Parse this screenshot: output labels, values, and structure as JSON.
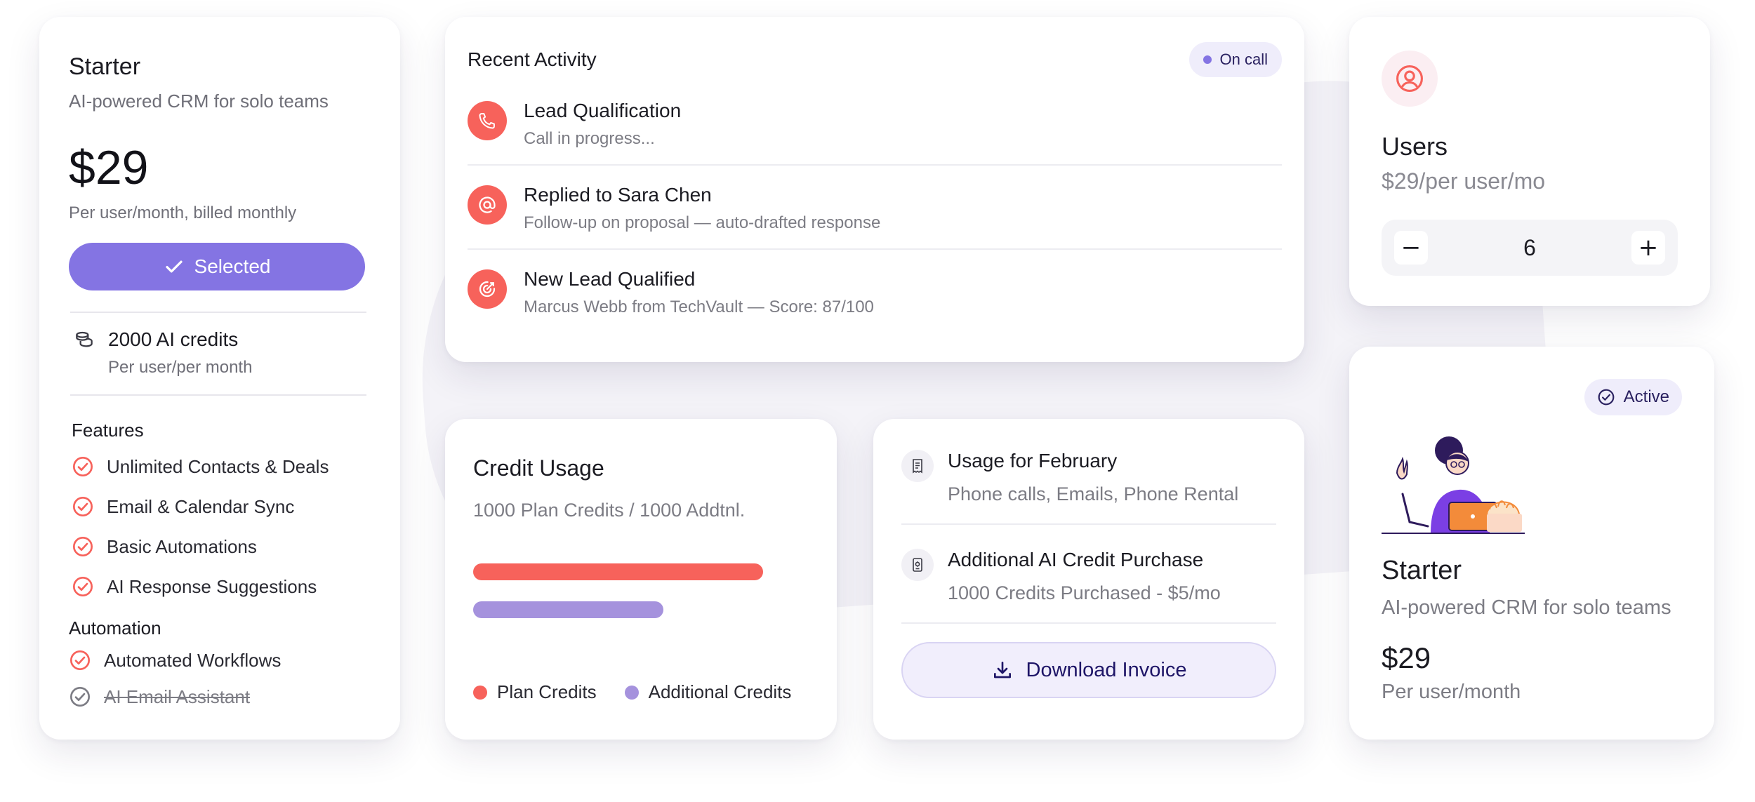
{
  "colors": {
    "accent": "#8474e3",
    "coral": "#f7625b",
    "lavender": "#a592dd"
  },
  "starter_card": {
    "title": "Starter",
    "subtitle": "AI-powered CRM for solo teams",
    "price": "$29",
    "price_note": "Per user/month, billed monthly",
    "selected_label": "Selected",
    "credits_main": "2000 AI credits",
    "credits_sub": "Per user/per month",
    "features_heading": "Features",
    "features": [
      {
        "label": "Unlimited Contacts & Deals"
      },
      {
        "label": "Email & Calendar Sync"
      },
      {
        "label": "Basic Automations"
      },
      {
        "label": "AI Response Suggestions"
      }
    ],
    "automation_heading": "Automation",
    "automation": [
      {
        "label": "Automated Workflows",
        "enabled": true
      },
      {
        "label": "AI Email Assistant",
        "enabled": false
      }
    ]
  },
  "activity": {
    "title": "Recent Activity",
    "status": "On call",
    "items": [
      {
        "icon": "phone-icon",
        "title": "Lead Qualification",
        "sub": "Call in progress..."
      },
      {
        "icon": "at-icon",
        "title": "Replied to Sara Chen",
        "sub": "Follow-up on proposal — auto-drafted response"
      },
      {
        "icon": "target-icon",
        "title": "New Lead Qualified",
        "sub": "Marcus Webb from TechVault — Score: 87/100"
      }
    ]
  },
  "credit_usage": {
    "title": "Credit Usage",
    "subtitle": "1000 Plan Credits / 1000 Addtnl.",
    "bars": [
      {
        "name": "Plan Credits",
        "fraction": 0.93,
        "color": "#f7625b"
      },
      {
        "name": "Additional Credits",
        "fraction": 0.61,
        "color": "#a592dd"
      }
    ]
  },
  "usage": {
    "items": [
      {
        "icon": "receipt-icon",
        "title": "Usage for February",
        "sub": "Phone calls, Emails, Phone Rental"
      },
      {
        "icon": "credit-receipt-icon",
        "title": "Additional AI Credit Purchase",
        "sub": "1000 Credits Purchased - $5/mo"
      }
    ],
    "button_label": "Download Invoice"
  },
  "users": {
    "title": "Users",
    "price": "$29/per user/mo",
    "count": "6",
    "minus": "−",
    "plus": "+"
  },
  "active_plan": {
    "status": "Active",
    "title": "Starter",
    "subtitle": "AI-powered CRM for solo teams",
    "price": "$29",
    "price_note": "Per user/month"
  }
}
